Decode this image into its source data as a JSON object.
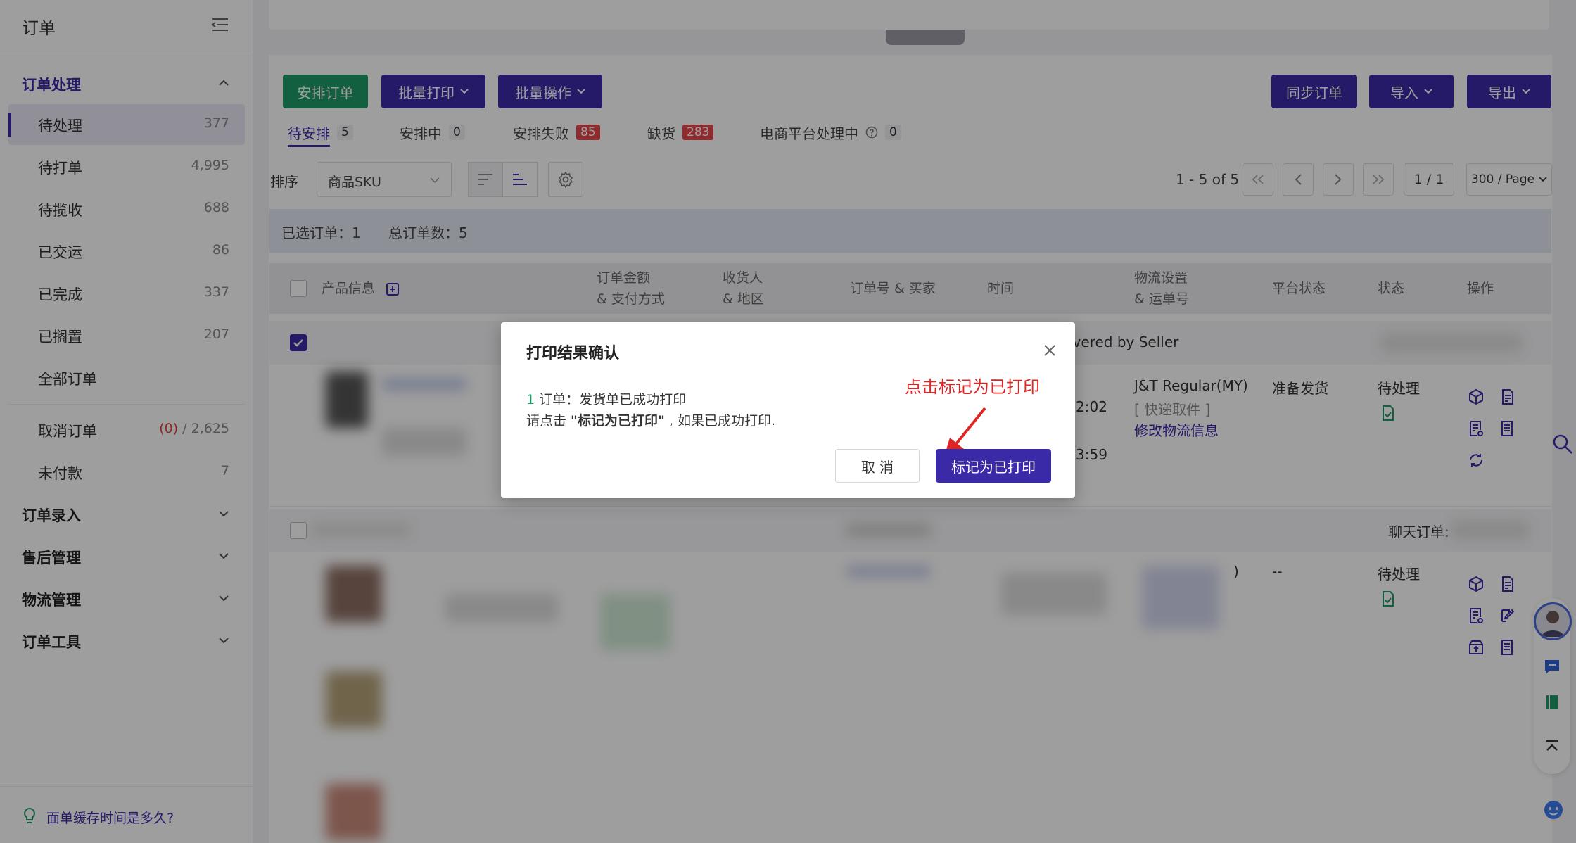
{
  "sidebar": {
    "title": "订单",
    "sections": {
      "processing": "订单处理",
      "entry": "订单录入",
      "aftersale": "售后管理",
      "logistics": "物流管理",
      "tools": "订单工具"
    },
    "items": [
      {
        "label": "待处理",
        "count": "377"
      },
      {
        "label": "待打单",
        "count": "4,995"
      },
      {
        "label": "待揽收",
        "count": "688"
      },
      {
        "label": "已交运",
        "count": "86"
      },
      {
        "label": "已完成",
        "count": "337"
      },
      {
        "label": "已搁置",
        "count": "207"
      },
      {
        "label": "全部订单",
        "count": ""
      }
    ],
    "cancel": {
      "label": "取消订单",
      "count_red": "(0)",
      "count_rest": " / 2,625"
    },
    "unpaid": {
      "label": "未付款",
      "count": "7"
    },
    "footer": "面单缓存时间是多久?"
  },
  "toolbar": {
    "arrange": "安排订单",
    "batch_print": "批量打印",
    "batch_ops": "批量操作",
    "sync": "同步订单",
    "import": "导入",
    "export": "导出"
  },
  "tabs": [
    {
      "label": "待安排",
      "count": "5"
    },
    {
      "label": "安排中",
      "count": "0"
    },
    {
      "label": "安排失败",
      "count": "85"
    },
    {
      "label": "缺货",
      "count": "283"
    },
    {
      "label": "电商平台处理中",
      "count": "0"
    }
  ],
  "filter": {
    "sort_label": "排序",
    "sort_value": "商品SKU"
  },
  "pager": {
    "range": "1 - 5 of 5",
    "page": "1 / 1",
    "per_page": "300 / Page"
  },
  "info": {
    "selected": "已选订单：1",
    "total": "总订单数：5"
  },
  "table": {
    "headers": {
      "product": "产品信息",
      "amount": "订单金额",
      "amount2": "& 支付方式",
      "receiver": "收货人",
      "receiver2": "& 地区",
      "orderno": "订单号 & 买家",
      "time": "时间",
      "logistics": "物流设置",
      "logistics2": "& 运单号",
      "platform": "平台状态",
      "status": "状态",
      "ops": "操作"
    },
    "row1": {
      "delivered": "ivered by Seller",
      "time1": "2:02",
      "time2": "3:59",
      "carrier": "J&T Regular(MY)",
      "pickup": "[ 快递取件 ]",
      "edit_logistics": "修改物流信息",
      "platform_status": "准备发货",
      "status": "待处理"
    },
    "row2": {
      "chat_label": "聊天订单:",
      "paren": ")",
      "platform_status": "--",
      "status": "待处理"
    }
  },
  "modal": {
    "title": "打印结果确认",
    "count": "1",
    "line1": " 订单：发货单已成功打印",
    "line2_pre": "请点击 ",
    "line2_bold": "\"标记为已打印\"",
    "line2_post": " , 如果已成功打印.",
    "annotation": "点击标记为已打印",
    "cancel": "取 消",
    "confirm": "标记为已打印"
  },
  "colors": {
    "primary": "#3b2aa8",
    "green": "#1d9b67",
    "red": "#e5484d",
    "annotation": "#e02424"
  }
}
